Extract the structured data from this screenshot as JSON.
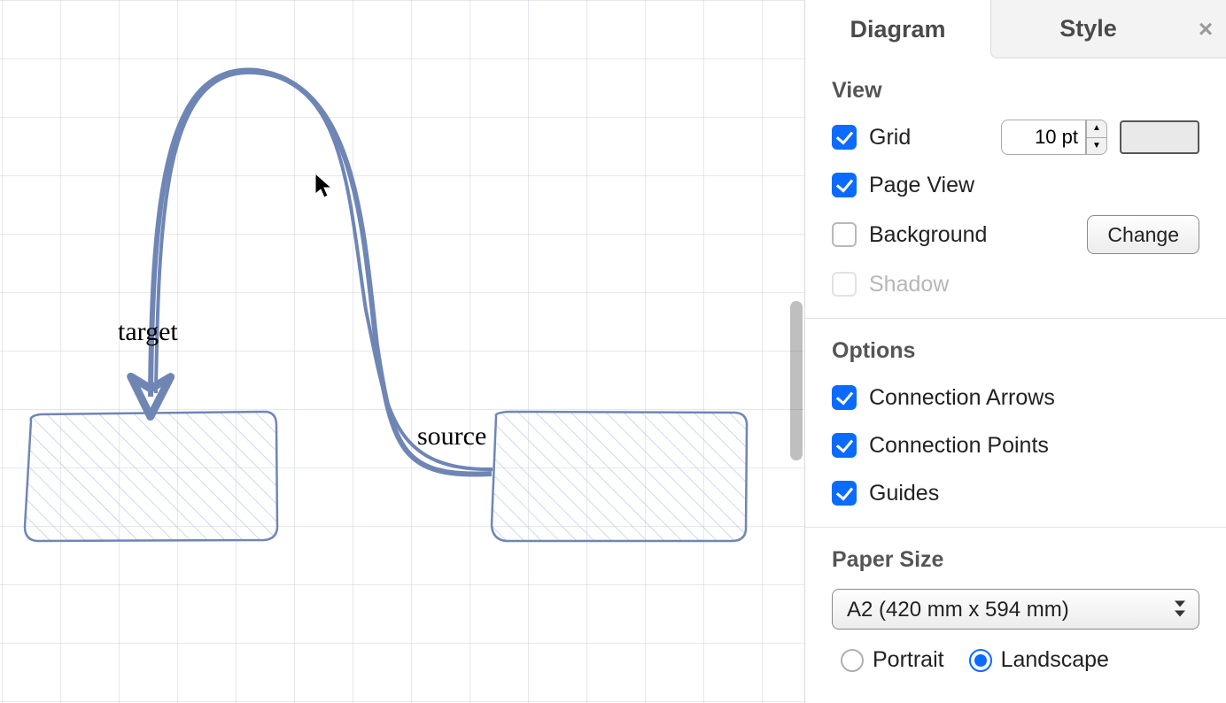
{
  "canvas": {
    "edge_labels": {
      "target": "target",
      "source": "source"
    }
  },
  "sidebar": {
    "tabs": {
      "diagram": "Diagram",
      "style": "Style"
    },
    "view": {
      "heading": "View",
      "grid": "Grid",
      "grid_value": "10 pt",
      "page_view": "Page View",
      "background": "Background",
      "change": "Change",
      "shadow": "Shadow"
    },
    "options": {
      "heading": "Options",
      "connection_arrows": "Connection Arrows",
      "connection_points": "Connection Points",
      "guides": "Guides"
    },
    "paper": {
      "heading": "Paper Size",
      "selected": "A2 (420 mm x 594 mm)",
      "portrait": "Portrait",
      "landscape": "Landscape"
    }
  }
}
